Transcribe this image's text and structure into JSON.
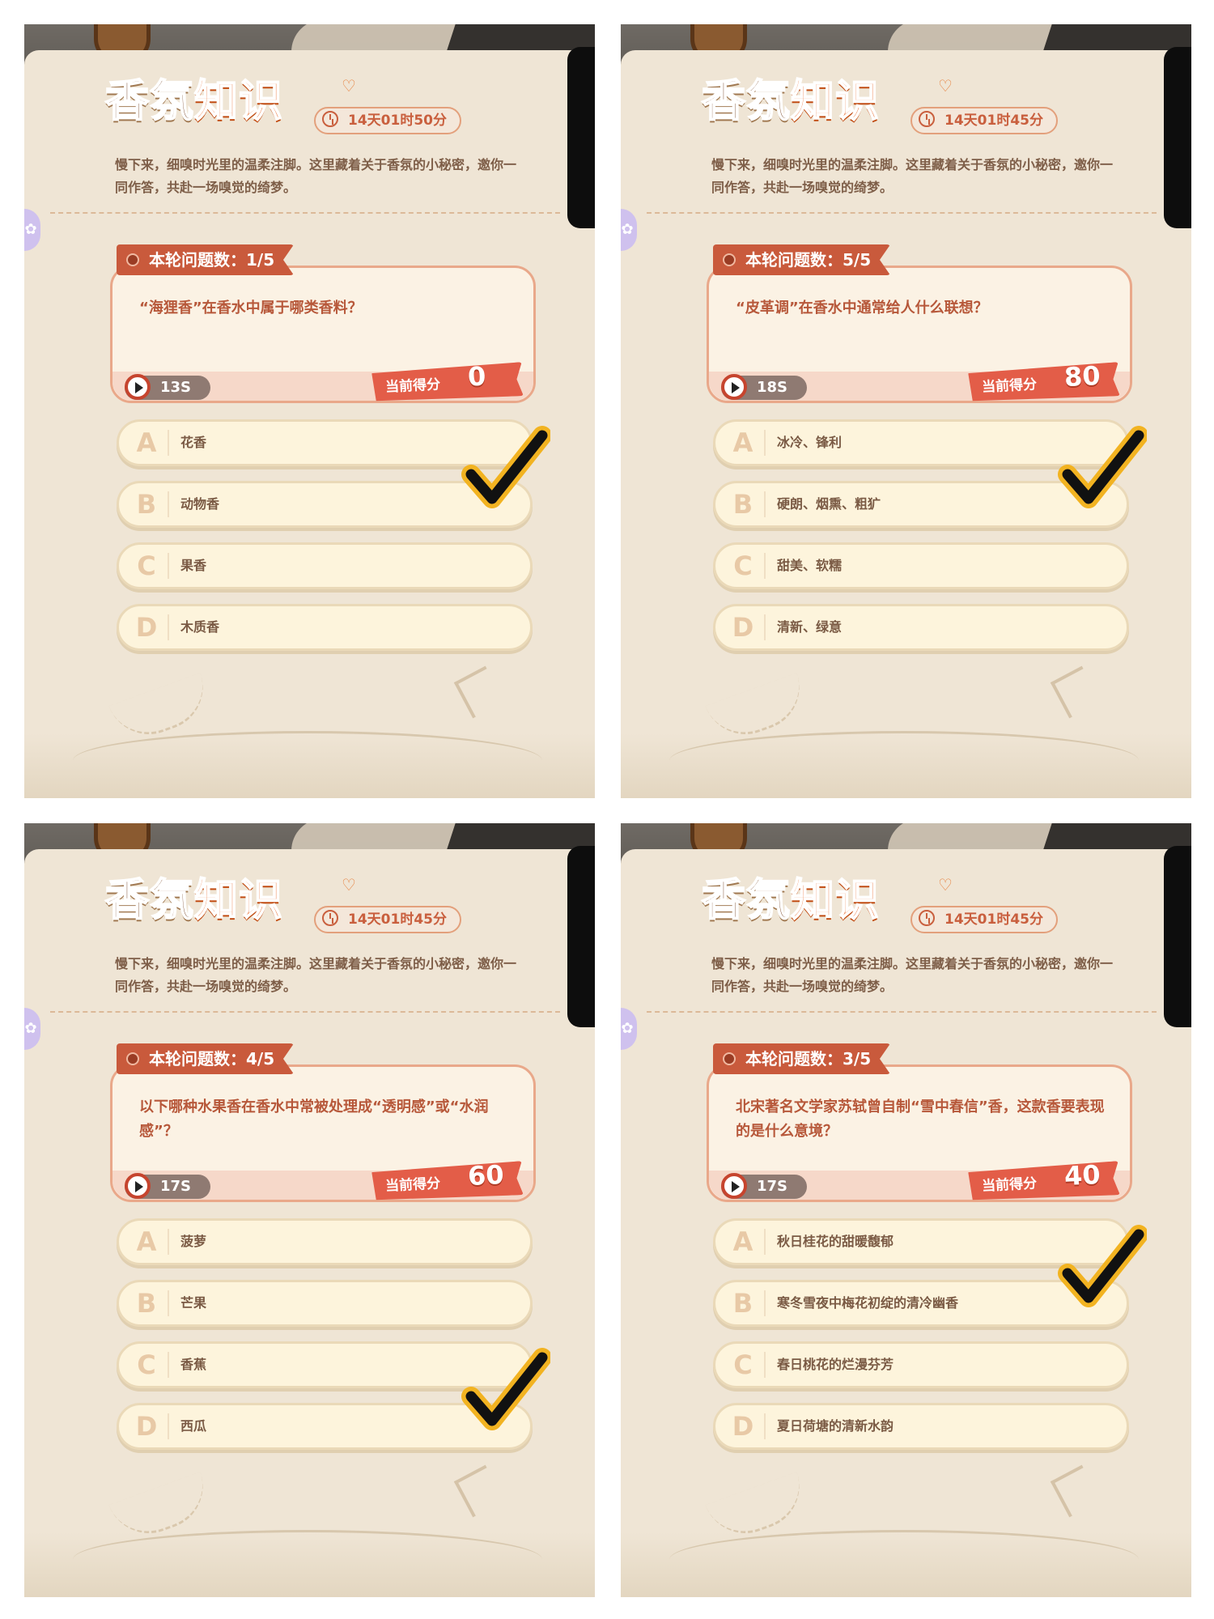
{
  "brand": {
    "part1": "香氛",
    "part2": "知识"
  },
  "intro": "慢下来，细嗅时光里的温柔注脚。这里藏着关于香氛的小秘密，邀你一同作答，共赴一场嗅觉的绮梦。",
  "score_label": "当前得分",
  "panels": [
    {
      "countdown": "14天01时50分",
      "round": "本轮问题数：1/5",
      "question": "“海狸香”在香水中属于哪类香料？",
      "timer": "13S",
      "score": "0",
      "answer": "B",
      "options": [
        {
          "letter": "A",
          "text": "花香"
        },
        {
          "letter": "B",
          "text": "动物香"
        },
        {
          "letter": "C",
          "text": "果香"
        },
        {
          "letter": "D",
          "text": "木质香"
        }
      ]
    },
    {
      "countdown": "14天01时45分",
      "round": "本轮问题数：5/5",
      "question": "“皮革调”在香水中通常给人什么联想？",
      "timer": "18S",
      "score": "80",
      "answer": "B",
      "options": [
        {
          "letter": "A",
          "text": "冰冷、锋利"
        },
        {
          "letter": "B",
          "text": "硬朗、烟熏、粗犷"
        },
        {
          "letter": "C",
          "text": "甜美、软糯"
        },
        {
          "letter": "D",
          "text": "清新、绿意"
        }
      ]
    },
    {
      "countdown": "14天01时45分",
      "round": "本轮问题数：4/5",
      "question": "以下哪种水果香在香水中常被处理成“透明感”或“水润感”？",
      "timer": "17S",
      "score": "60",
      "answer": "D",
      "options": [
        {
          "letter": "A",
          "text": "菠萝"
        },
        {
          "letter": "B",
          "text": "芒果"
        },
        {
          "letter": "C",
          "text": "香蕉"
        },
        {
          "letter": "D",
          "text": "西瓜"
        }
      ]
    },
    {
      "countdown": "14天01时45分",
      "round": "本轮问题数：3/5",
      "question": "北宋著名文学家苏轼曾自制“雪中春信”香，这款香要表现的是什么意境？",
      "timer": "17S",
      "score": "40",
      "answer": "B",
      "options": [
        {
          "letter": "A",
          "text": "秋日桂花的甜暖馥郁"
        },
        {
          "letter": "B",
          "text": "寒冬雪夜中梅花初绽的清冷幽香"
        },
        {
          "letter": "C",
          "text": "春日桃花的烂漫芬芳"
        },
        {
          "letter": "D",
          "text": "夏日荷塘的清新水韵"
        }
      ]
    }
  ]
}
